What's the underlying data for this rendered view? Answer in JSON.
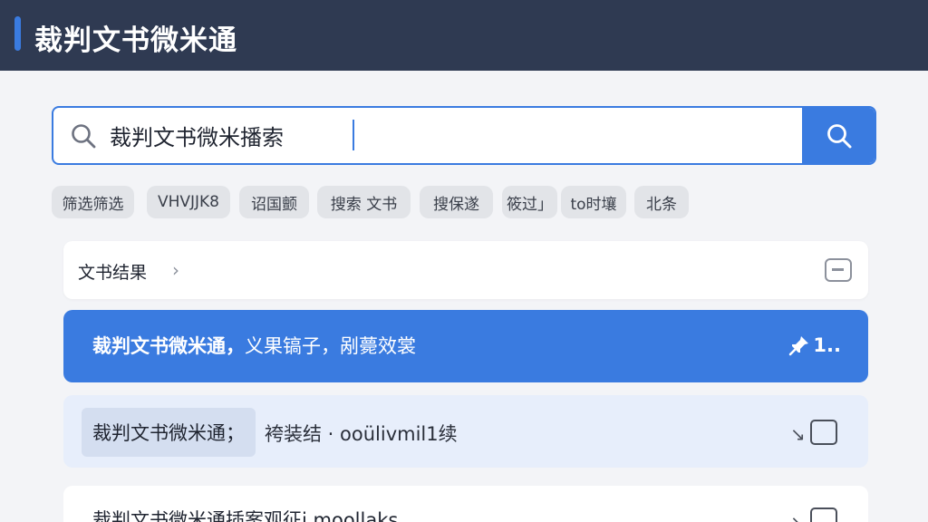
{
  "header": {
    "title": "裁判文书微米通"
  },
  "search": {
    "value": "裁判文书微米播索"
  },
  "chips": [
    {
      "label": "筛选筛选"
    },
    {
      "label": "VHVJJK8"
    },
    {
      "label": "诏国颤"
    },
    {
      "label": "搜索 文书"
    },
    {
      "label": "搜保遂"
    },
    {
      "label": "筱过」"
    },
    {
      "label": "to时壤"
    },
    {
      "label": "北条"
    }
  ],
  "results": {
    "header_label": "文书结果",
    "items": [
      {
        "title": "裁判文书微米通，",
        "subtitle": "义果镐子，剐薨效裳",
        "badge": "1.."
      },
      {
        "title": "裁判文书微米通；",
        "subtitle": "袴装结 · ooülivmil1续"
      },
      {
        "title": "裁判文书微米通插案观征",
        "subtitle": "i moollaks"
      }
    ]
  },
  "colors": {
    "header_bg": "#2f3a52",
    "accent": "#3a7be0",
    "page_bg": "#f3f4f7",
    "chip_bg": "#e2e4e8",
    "item_highlight_bg": "#e7eefb"
  },
  "icons": {
    "search_left": "search-icon",
    "search_button": "search-icon",
    "collapse": "collapse-icon",
    "pin": "pin-icon",
    "row_action": "share-icon"
  }
}
